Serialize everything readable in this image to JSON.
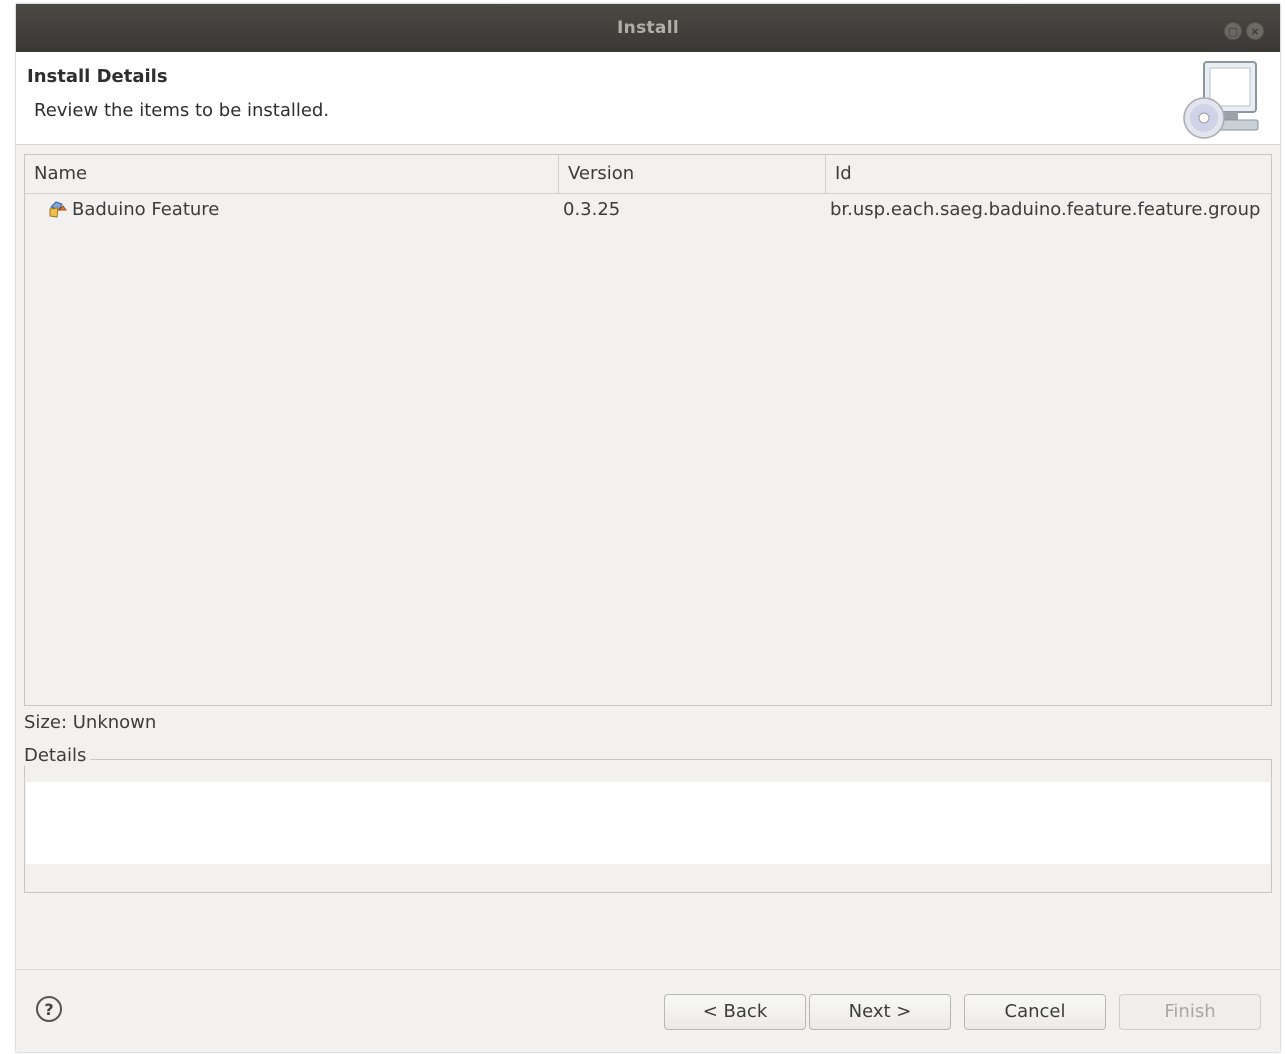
{
  "window": {
    "title": "Install"
  },
  "header": {
    "title": "Install Details",
    "subtitle": "Review the items to be installed."
  },
  "table": {
    "columns": [
      "Name",
      "Version",
      "Id"
    ],
    "rows": [
      {
        "name": "Baduino Feature",
        "version": "0.3.25",
        "id": "br.usp.each.saeg.baduino.feature.feature.group",
        "icon": "feature-icon"
      }
    ]
  },
  "size_text": "Size: Unknown",
  "details": {
    "label": "Details"
  },
  "footer": {
    "help_glyph": "?",
    "back_label": "< Back",
    "next_label": "Next >",
    "cancel_label": "Cancel",
    "finish_label": "Finish"
  }
}
